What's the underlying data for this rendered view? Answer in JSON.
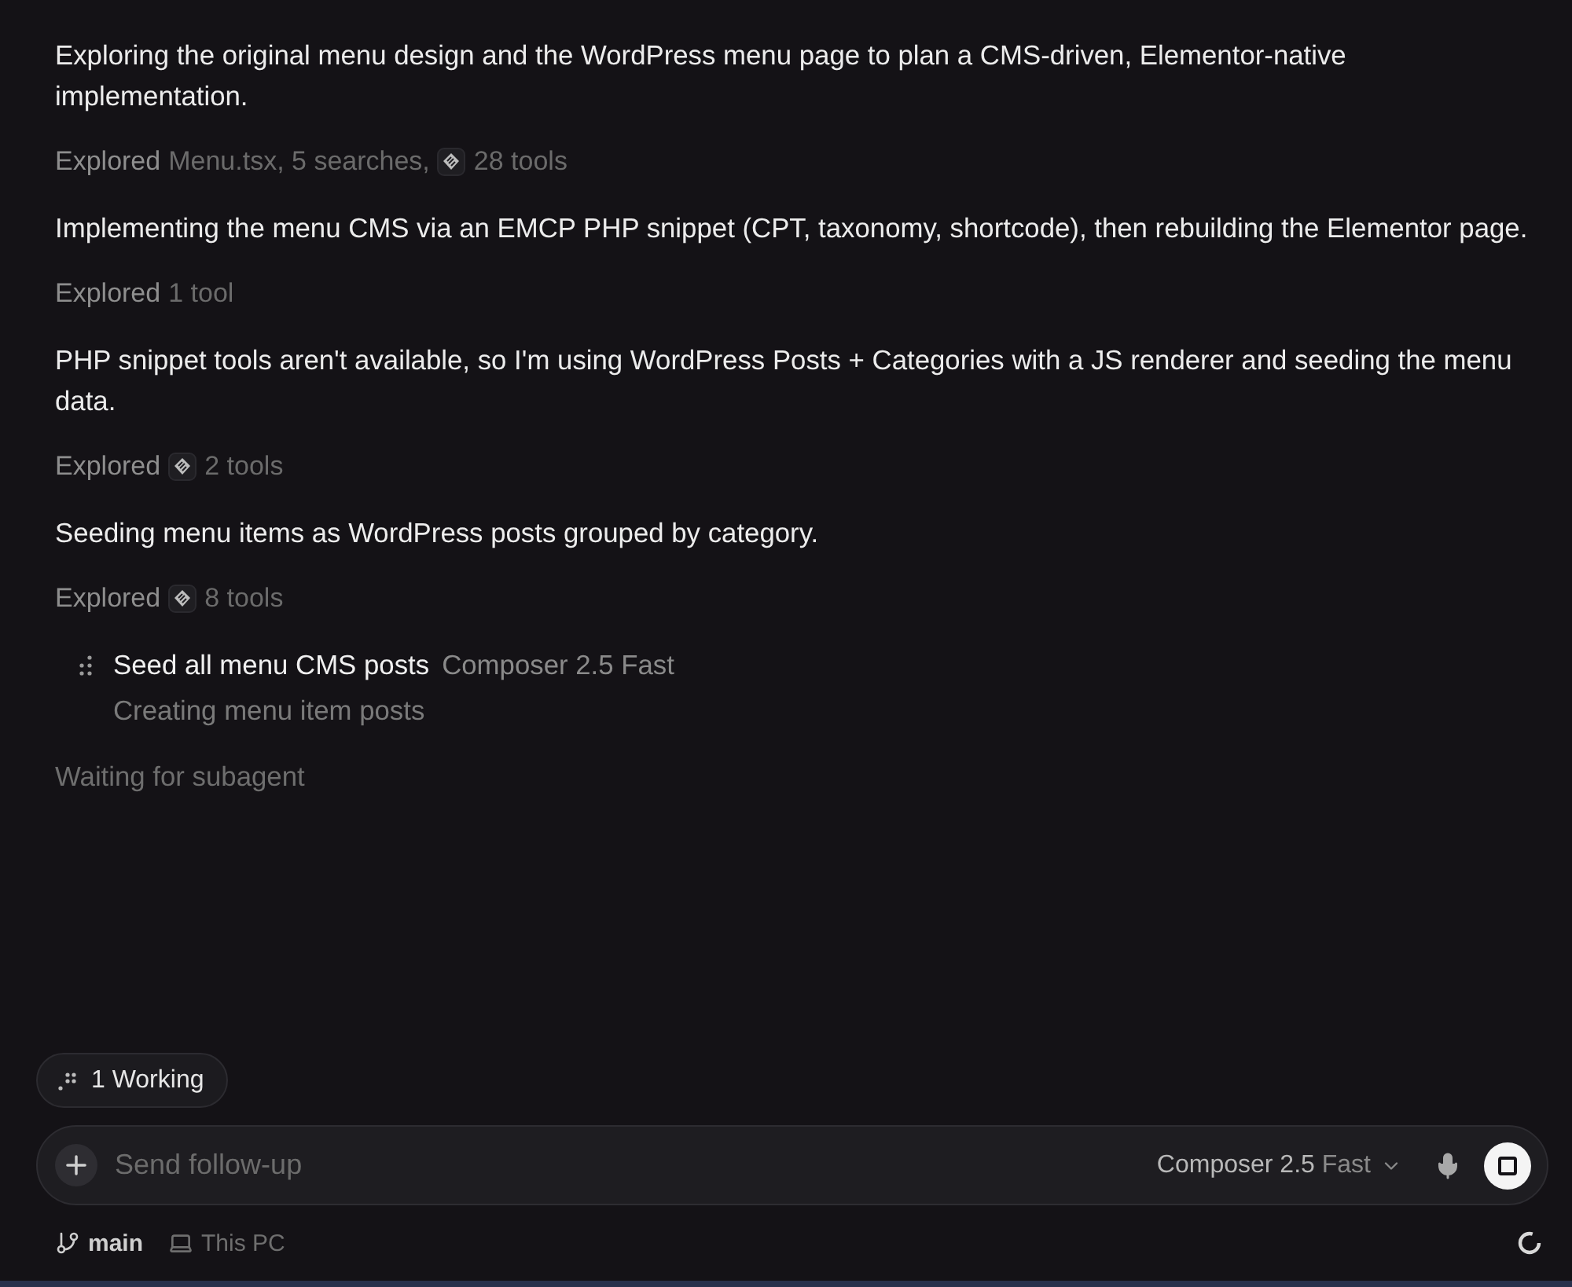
{
  "transcript": [
    {
      "kind": "message",
      "text": "Exploring the original menu design and the WordPress menu page to plan a CMS-driven, Elementor-native implementation."
    },
    {
      "kind": "explored",
      "label": "Explored",
      "summary": "Menu.tsx, 5 searches,",
      "tool_icon": true,
      "count": "28 tools"
    },
    {
      "kind": "message",
      "text": "Implementing the menu CMS via an EMCP PHP snippet (CPT, taxonomy, shortcode), then rebuilding the Elementor page."
    },
    {
      "kind": "explored",
      "label": "Explored",
      "tool_icon": false,
      "count": "1 tool"
    },
    {
      "kind": "message",
      "text": "PHP snippet tools aren't available, so I'm using WordPress Posts + Categories with a JS renderer and seeding the menu data."
    },
    {
      "kind": "explored",
      "label": "Explored",
      "tool_icon": true,
      "count": "2 tools"
    },
    {
      "kind": "message",
      "text": "Seeding menu items as WordPress posts grouped by category."
    },
    {
      "kind": "explored",
      "label": "Explored",
      "tool_icon": true,
      "count": "8 tools"
    },
    {
      "kind": "subagent",
      "title": "Seed all menu CMS posts",
      "model": "Composer 2.5 Fast",
      "status": "Creating menu item posts"
    },
    {
      "kind": "status",
      "text": "Waiting for subagent"
    }
  ],
  "working": {
    "label": "1 Working"
  },
  "composer": {
    "placeholder": "Send follow-up",
    "model": "Composer 2.5",
    "mode": "Fast"
  },
  "footer": {
    "branch": "main",
    "location": "This PC"
  }
}
